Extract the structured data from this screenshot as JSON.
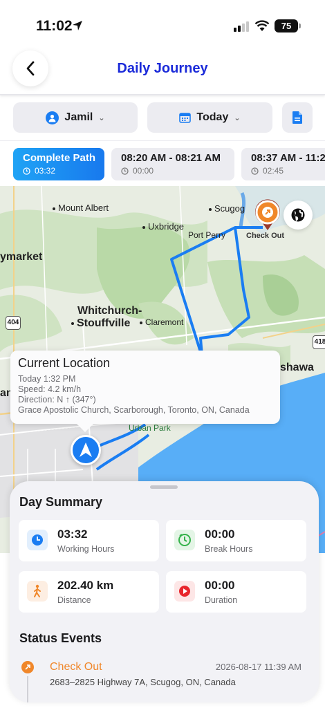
{
  "status_bar": {
    "time": "11:02",
    "battery": "75"
  },
  "header": {
    "title": "Daily Journey"
  },
  "filters": {
    "user": "Jamil",
    "date": "Today"
  },
  "segments": [
    {
      "label": "Complete Path",
      "duration": "03:32"
    },
    {
      "label": "08:20 AM - 08:21 AM",
      "duration": "00:00"
    },
    {
      "label": "08:37 AM - 11:2",
      "duration": "02:45"
    }
  ],
  "map": {
    "places": [
      "Mount Albert",
      "Uxbridge",
      "Scugog",
      "Port Perry",
      "ymarket",
      "Whitchurch-",
      "Stouffville",
      "Claremont",
      "shawa",
      "Urban Park",
      "an"
    ],
    "highways": [
      "404",
      "418"
    ],
    "checkout_label": "Check Out"
  },
  "tooltip": {
    "title": "Current Location",
    "time": "Today 1:32 PM",
    "speed": "Speed: 4.2 km/h",
    "direction": "Direction: N ↑ (347°)",
    "address": "Grace Apostolic Church, Scarborough, Toronto, ON, Canada"
  },
  "summary": {
    "title": "Day Summary",
    "working_hours": {
      "value": "03:32",
      "label": "Working Hours"
    },
    "break_hours": {
      "value": "00:00",
      "label": "Break Hours"
    },
    "distance": {
      "value": "202.40 km",
      "label": "Distance"
    },
    "duration": {
      "value": "00:00",
      "label": "Duration"
    }
  },
  "status_events": {
    "title": "Status Events",
    "items": [
      {
        "title": "Check Out",
        "datetime": "2026-08-17 11:39 AM",
        "address": "2683–2825 Highway 7A, Scugog, ON, Canada"
      }
    ]
  },
  "colors": {
    "accent": "#1a7df2",
    "title": "#1a2ad9",
    "route": "#1a7df2",
    "checkout": "#f0872a"
  }
}
